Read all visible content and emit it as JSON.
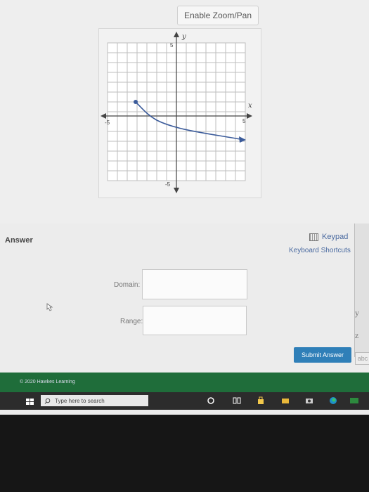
{
  "graph": {
    "zoom_button": "Enable Zoom/Pan",
    "y_axis_label": "y",
    "x_axis_label": "x",
    "tick_y_top": "5",
    "tick_y_bottom": "-5",
    "tick_x_left": "-5",
    "tick_x_right": "5"
  },
  "answer": {
    "label": "Answer",
    "keypad": "Keypad",
    "shortcuts": "Keyboard Shortcuts",
    "domain_label": "Domain:",
    "range_label": "Range:",
    "submit": "Submit Answer",
    "side_chars": [
      "y",
      "z"
    ],
    "side_tab": "abc"
  },
  "footer": {
    "copyright": "© 2020 Hawkes Learning"
  },
  "taskbar": {
    "search_placeholder": "Type here to search"
  },
  "colors": {
    "curve": "#3b5b9a",
    "submit": "#2f7fb8",
    "footer": "#1f6d3a",
    "taskbar": "#2c2c2c"
  }
}
